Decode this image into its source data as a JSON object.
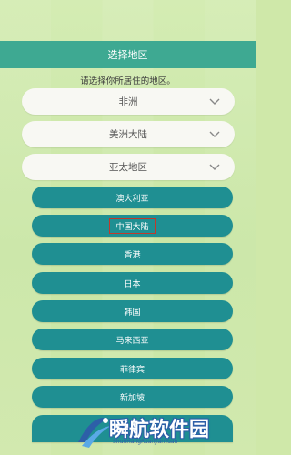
{
  "header": {
    "title": "选择地区"
  },
  "prompt": "请选择你所居住的地区。",
  "regions": [
    {
      "label": "非洲",
      "icon": "chevron-down-icon"
    },
    {
      "label": "美洲大陆",
      "icon": "chevron-down-icon"
    },
    {
      "label": "亚太地区",
      "icon": "chevron-down-icon"
    }
  ],
  "countries": [
    {
      "label": "澳大利亚"
    },
    {
      "label": "中国大陆",
      "selected": true
    },
    {
      "label": "香港"
    },
    {
      "label": "日本"
    },
    {
      "label": "韩国"
    },
    {
      "label": "马来西亚"
    },
    {
      "label": "菲律宾"
    },
    {
      "label": "新加坡"
    }
  ],
  "watermark": {
    "title": "瞬航软件园",
    "subtitle": "ShunHangRuanJianYuan"
  },
  "colors": {
    "titlebar": "#3ea992",
    "country_button": "#1f8f92",
    "highlight_border": "#c0392b"
  }
}
